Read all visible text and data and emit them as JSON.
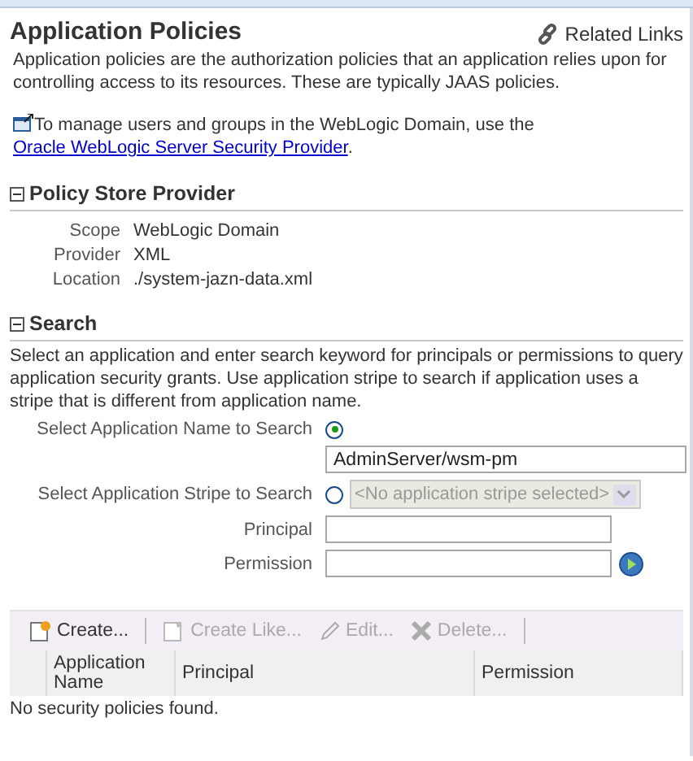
{
  "header": {
    "title": "Application Policies",
    "related_links": "Related Links"
  },
  "intro": "Application policies are the authorization policies that an application relies upon for controlling access to its resources. These are typically JAAS policies.",
  "manage_note": {
    "text": "To manage users and groups in the WebLogic Domain, use the ",
    "link": "Oracle WebLogic Server Security Provider",
    "suffix": "."
  },
  "policy_store": {
    "title": "Policy Store Provider",
    "expanded": true,
    "rows": [
      {
        "label": "Scope",
        "value": "WebLogic Domain"
      },
      {
        "label": "Provider",
        "value": "XML"
      },
      {
        "label": "Location",
        "value": "./system-jazn-data.xml"
      }
    ]
  },
  "search": {
    "title": "Search",
    "expanded": true,
    "description": "Select an application and enter search keyword for principals or permissions to query application security grants. Use application stripe to search if application uses a stripe that is different from application name.",
    "app_name": {
      "label": "Select Application Name to Search",
      "selected": true,
      "value": "AdminServer/wsm-pm"
    },
    "app_stripe": {
      "label": "Select Application Stripe to Search",
      "selected": false,
      "dropdown": "<No application stripe selected>",
      "disabled": true
    },
    "principal": {
      "label": "Principal"
    },
    "permission": {
      "label": "Permission"
    }
  },
  "toolbar": [
    {
      "label": "Create...",
      "kind": "create",
      "disabled": false
    },
    {
      "label": "Create Like...",
      "kind": "create-like",
      "disabled": true
    },
    {
      "label": "Edit...",
      "kind": "edit",
      "disabled": true
    },
    {
      "label": "Delete...",
      "kind": "delete",
      "disabled": true
    }
  ],
  "table": {
    "columns": [
      "Application Name",
      "Principal",
      "Permission"
    ],
    "empty_message": "No security policies found."
  }
}
